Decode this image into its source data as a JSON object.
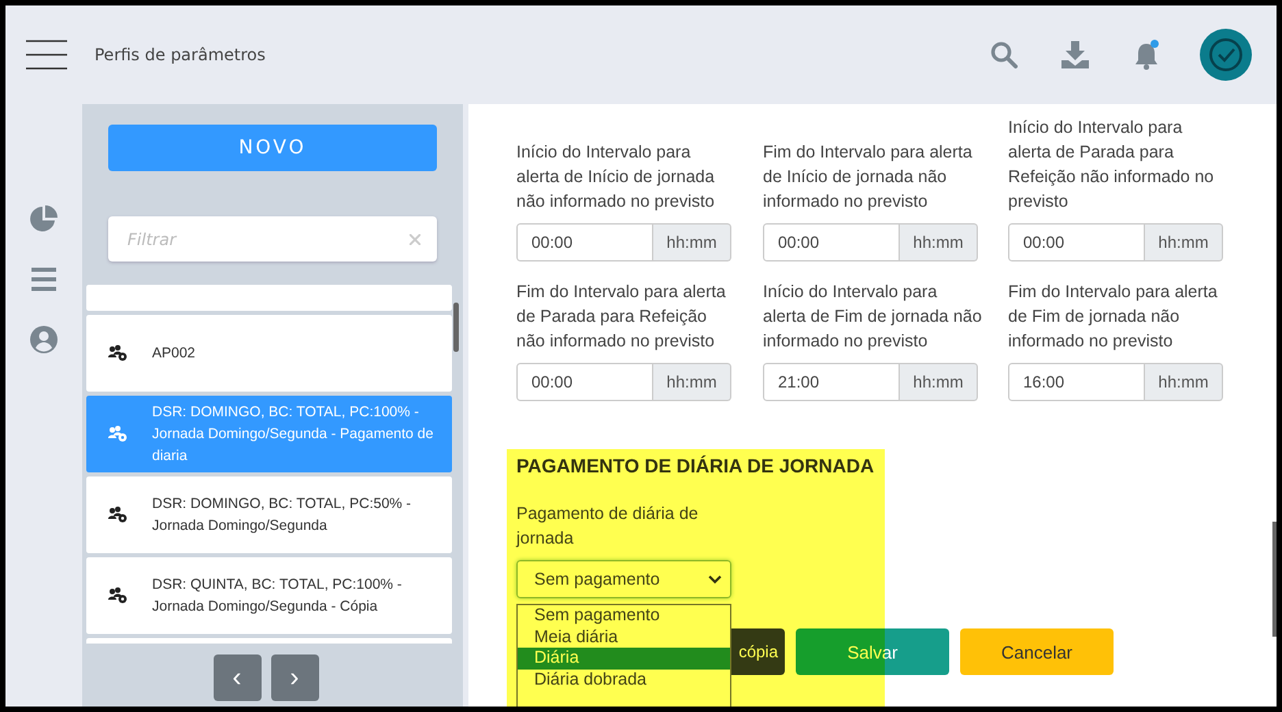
{
  "header": {
    "title": "Perfis de parâmetros"
  },
  "sidebar": {
    "new_button": "NOVO",
    "filter": {
      "placeholder": "Filtrar"
    },
    "items": [
      {
        "label": "AP002",
        "selected": false
      },
      {
        "label": "DSR: DOMINGO, BC: TOTAL, PC:100% - Jornada Domingo/Segunda - Pagamento de diaria",
        "selected": true
      },
      {
        "label": "DSR: DOMINGO, BC: TOTAL, PC:50% - Jornada Domingo/Segunda",
        "selected": false
      },
      {
        "label": "DSR: QUINTA, BC: TOTAL, PC:100% - Jornada Domingo/Segunda - Cópia",
        "selected": false
      }
    ],
    "pagination": [
      "‹",
      "›"
    ]
  },
  "fields": [
    {
      "label": "Início do Intervalo para alerta de Início de jornada não informado no previsto",
      "value": "00:00",
      "unit": "hh:mm"
    },
    {
      "label": "Fim do Intervalo para alerta de Início de jornada não informado no previsto",
      "value": "00:00",
      "unit": "hh:mm"
    },
    {
      "label": "Início do Intervalo para alerta de Parada para Refeição não informado no previsto",
      "value": "00:00",
      "unit": "hh:mm"
    },
    {
      "label": "Fim do Intervalo para alerta de Parada para Refeição não informado no previsto",
      "value": "00:00",
      "unit": "hh:mm"
    },
    {
      "label": "Início do Intervalo para alerta de Fim de jornada não informado no previsto",
      "value": "21:00",
      "unit": "hh:mm"
    },
    {
      "label": "Fim do Intervalo para alerta de Fim de jornada não informado no previsto",
      "value": "16:00",
      "unit": "hh:mm"
    }
  ],
  "payment_section": {
    "title": "PAGAMENTO DE DIÁRIA DE JORNADA",
    "label": "Pagamento de diária de jornada",
    "select": {
      "value": "Sem pagamento"
    },
    "options": [
      {
        "label": "Sem pagamento",
        "selected": false
      },
      {
        "label": "Meia diária",
        "selected": false
      },
      {
        "label": "Diária",
        "selected": true
      },
      {
        "label": "Diária dobrada",
        "selected": false
      }
    ]
  },
  "buttons": [
    {
      "label": "cópia",
      "kind": "dark"
    },
    {
      "label": "Salvar",
      "kind": "save"
    },
    {
      "label": "Cancelar",
      "kind": "cancel"
    }
  ]
}
